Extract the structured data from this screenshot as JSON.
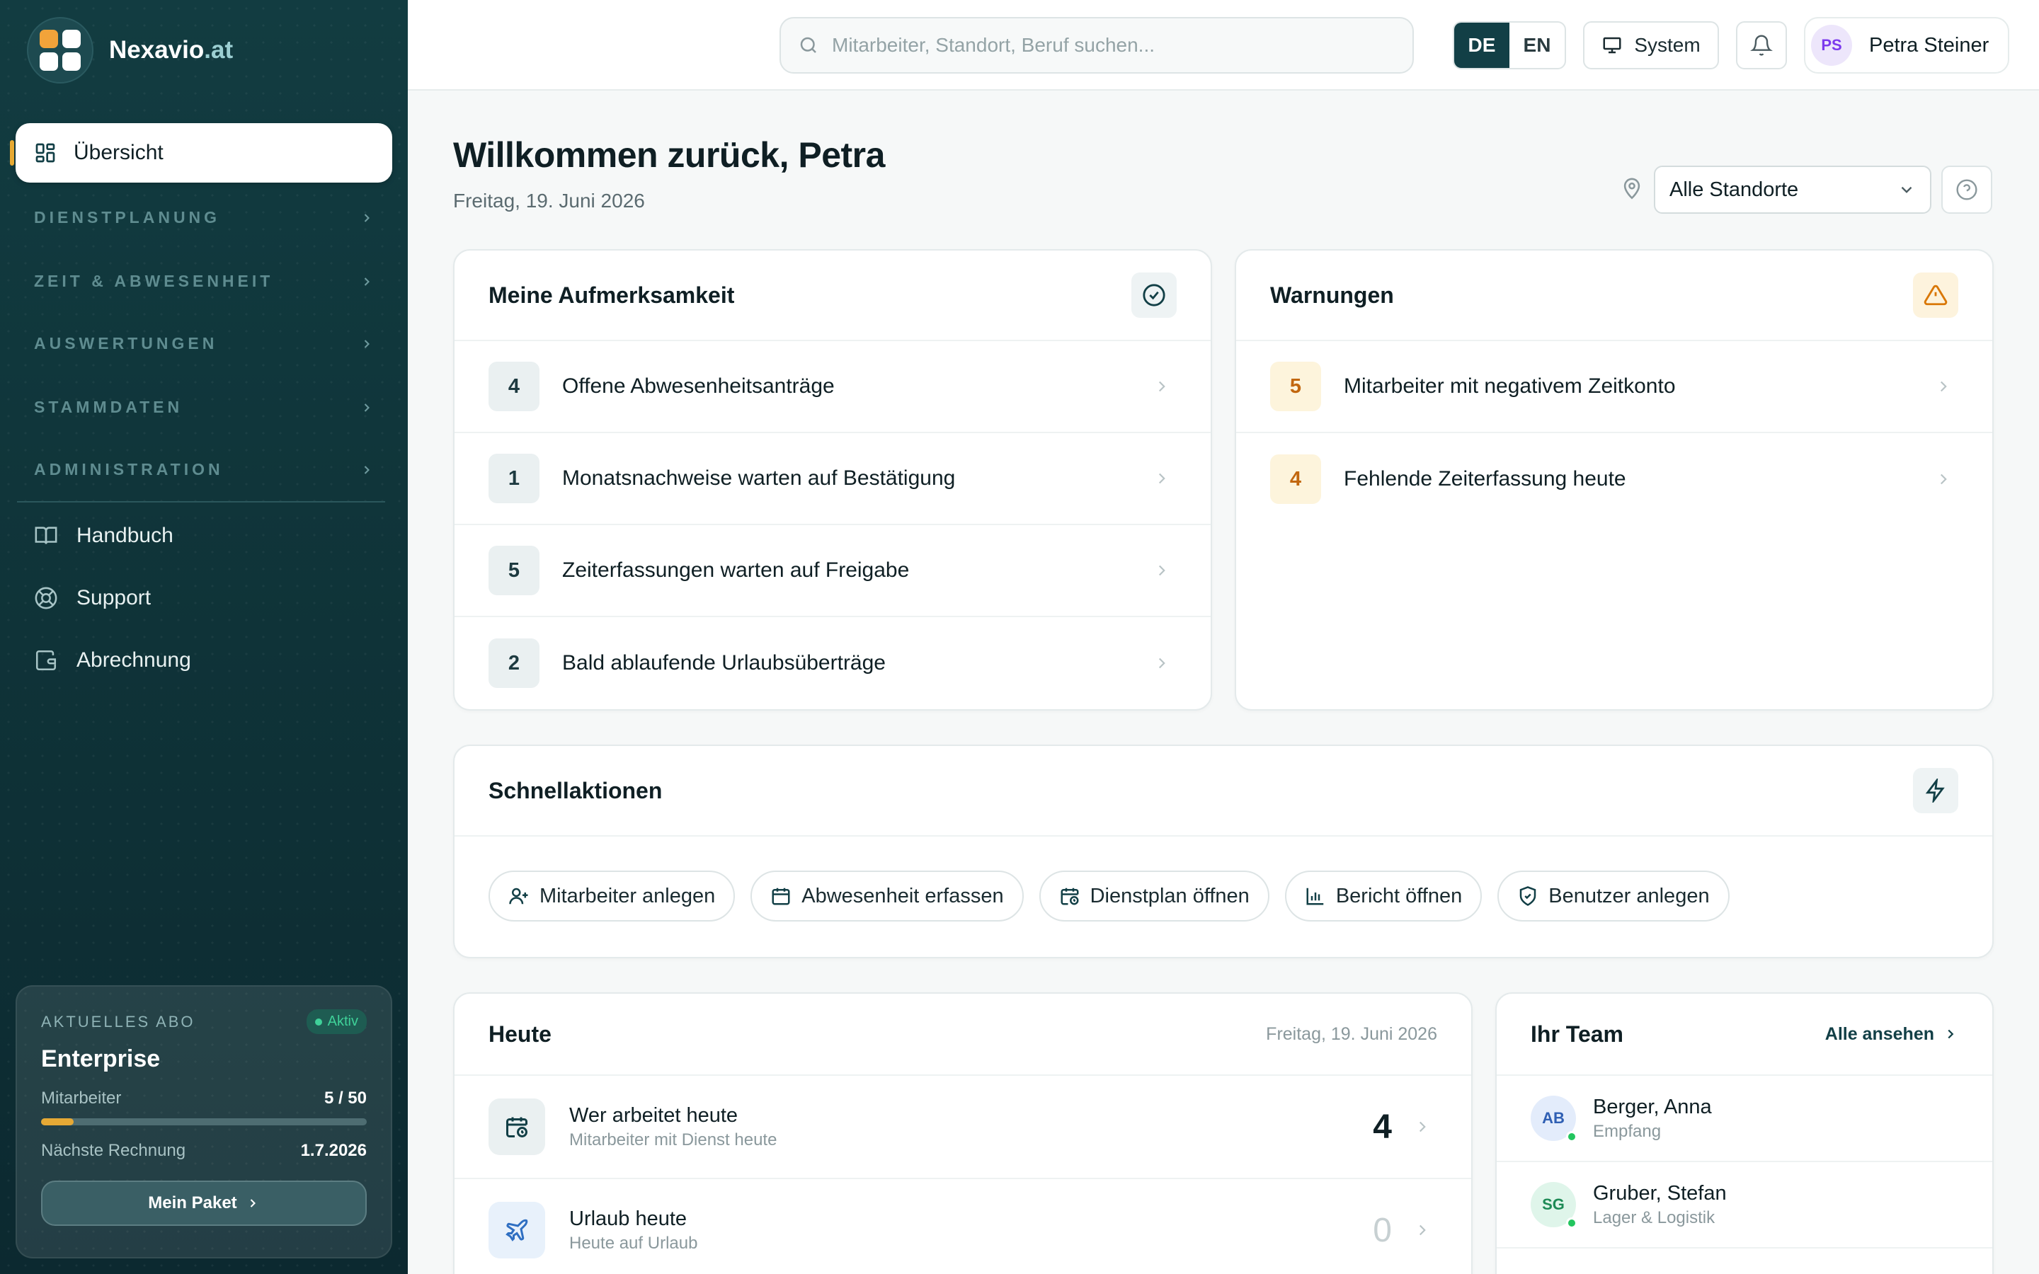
{
  "brand": {
    "name": "Nexavio",
    "tld": ".at"
  },
  "sidebar": {
    "active": {
      "label": "Übersicht",
      "icon": "grid-icon"
    },
    "sections": [
      {
        "label": "DIENSTPLANUNG"
      },
      {
        "label": "ZEIT & ABWESENHEIT"
      },
      {
        "label": "AUSWERTUNGEN"
      },
      {
        "label": "STAMMDATEN"
      },
      {
        "label": "ADMINISTRATION"
      }
    ],
    "links": [
      {
        "label": "Handbuch",
        "icon": "book-icon"
      },
      {
        "label": "Support",
        "icon": "lifebuoy-icon"
      },
      {
        "label": "Abrechnung",
        "icon": "wallet-icon"
      }
    ],
    "subscription": {
      "label": "AKTUELLES ABO",
      "status": "Aktiv",
      "plan": "Enterprise",
      "employees_label": "Mitarbeiter",
      "employees_value": "5 / 50",
      "employees_fraction": 0.1,
      "next_invoice_label": "Nächste Rechnung",
      "next_invoice_value": "1.7.2026",
      "button": "Mein Paket"
    }
  },
  "topbar": {
    "search_placeholder": "Mitarbeiter, Standort, Beruf suchen...",
    "lang": [
      "DE",
      "EN"
    ],
    "lang_active": "DE",
    "theme_label": "System",
    "user": {
      "initials": "PS",
      "name": "Petra Steiner"
    }
  },
  "header": {
    "title": "Willkommen zurück, Petra",
    "date": "Freitag, 19. Juni 2026",
    "location_select": "Alle Standorte"
  },
  "attention": {
    "title": "Meine Aufmerksamkeit",
    "items": [
      {
        "count": "4",
        "label": "Offene Abwesenheitsanträge"
      },
      {
        "count": "1",
        "label": "Monatsnachweise warten auf Bestätigung"
      },
      {
        "count": "5",
        "label": "Zeiterfassungen warten auf Freigabe"
      },
      {
        "count": "2",
        "label": "Bald ablaufende Urlaubsüberträge"
      }
    ]
  },
  "warnings": {
    "title": "Warnungen",
    "items": [
      {
        "count": "5",
        "label": "Mitarbeiter mit negativem Zeitkonto"
      },
      {
        "count": "4",
        "label": "Fehlende Zeiterfassung heute"
      }
    ]
  },
  "quick_actions": {
    "title": "Schnellaktionen",
    "items": [
      {
        "label": "Mitarbeiter anlegen",
        "icon": "user-plus-icon"
      },
      {
        "label": "Abwesenheit erfassen",
        "icon": "calendar-icon"
      },
      {
        "label": "Dienstplan öffnen",
        "icon": "calendar-clock-icon"
      },
      {
        "label": "Bericht öffnen",
        "icon": "bar-chart-icon"
      },
      {
        "label": "Benutzer anlegen",
        "icon": "shield-icon"
      }
    ]
  },
  "today": {
    "title": "Heute",
    "date": "Freitag, 19. Juni 2026",
    "items": [
      {
        "title": "Wer arbeitet heute",
        "subtitle": "Mitarbeiter mit Dienst heute",
        "value": "4"
      },
      {
        "title": "Urlaub heute",
        "subtitle": "Heute auf Urlaub",
        "value": "0"
      }
    ]
  },
  "team": {
    "title": "Ihr Team",
    "see_all": "Alle ansehen",
    "members": [
      {
        "initials": "AB",
        "name": "Berger, Anna",
        "role": "Empfang",
        "color": "#e3ecfb",
        "text_color": "#2f5fb3"
      },
      {
        "initials": "SG",
        "name": "Gruber, Stefan",
        "role": "Lager & Logistik",
        "color": "#dff5ea",
        "text_color": "#1d8a55"
      }
    ]
  }
}
